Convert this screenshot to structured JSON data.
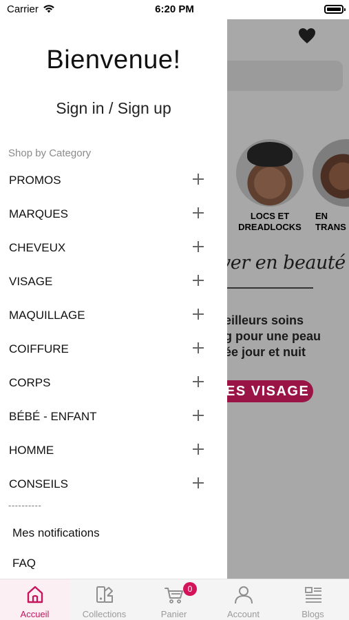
{
  "status_bar": {
    "carrier": "Carrier",
    "time": "6:20 PM"
  },
  "drawer": {
    "welcome": "Bienvenue!",
    "sign_in": "Sign in / Sign up",
    "section_title": "Shop by Category",
    "categories": [
      {
        "label": "PROMOS"
      },
      {
        "label": "MARQUES"
      },
      {
        "label": "CHEVEUX"
      },
      {
        "label": "VISAGE"
      },
      {
        "label": "MAQUILLAGE"
      },
      {
        "label": "COIFFURE"
      },
      {
        "label": "CORPS"
      },
      {
        "label": "BÉBÉ - ENFANT"
      },
      {
        "label": "HOMME"
      },
      {
        "label": "CONSEILS"
      }
    ],
    "divider": "----------",
    "extra_items": [
      {
        "label": "Mes notifications"
      },
      {
        "label": "FAQ"
      }
    ]
  },
  "background_page": {
    "circle_1_label": "LOCS ET\nDREADLOCKS",
    "circle_2_label": "EN\nTRANS",
    "script_heading": "ver en beauté",
    "promo_text": "eilleurs soins\ng pour une peau\née jour et nuit",
    "promo_button": "ES VISAGE",
    "accent_color": "#9a1445"
  },
  "tabbar": {
    "tabs": [
      {
        "label": "Accueil",
        "icon": "home-icon"
      },
      {
        "label": "Collections",
        "icon": "collections-icon"
      },
      {
        "label": "Panier",
        "icon": "cart-icon"
      },
      {
        "label": "Account",
        "icon": "account-icon"
      },
      {
        "label": "Blogs",
        "icon": "blogs-icon"
      }
    ],
    "cart_count": "0",
    "active_color": "#c7135c"
  }
}
